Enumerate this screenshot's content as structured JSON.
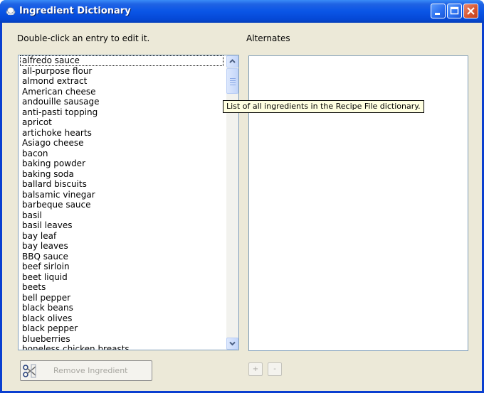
{
  "window": {
    "title": "Ingredient Dictionary",
    "colors": {
      "titlebar": "#0a55e6",
      "frame": "#0a3fd0",
      "body": "#ece9d8",
      "tooltip_bg": "#ffffe1"
    }
  },
  "left_panel": {
    "instruction": "Double-click an entry to edit it.",
    "ingredients": [
      "alfredo sauce",
      "all-purpose flour",
      "almond extract",
      "American cheese",
      "andouille sausage",
      "anti-pasti topping",
      "apricot",
      "artichoke hearts",
      "Asiago cheese",
      "bacon",
      "baking powder",
      "baking soda",
      "ballard biscuits",
      "balsamic vinegar",
      "barbeque sauce",
      "basil",
      "basil leaves",
      "bay leaf",
      "bay leaves",
      "BBQ sauce",
      "beef sirloin",
      "beet liquid",
      "beets",
      "bell pepper",
      "black beans",
      "black olives",
      "black pepper",
      "blueberries",
      "boneless chicken breasts"
    ],
    "selected_index": 0
  },
  "right_panel": {
    "label": "Alternates",
    "items": []
  },
  "tooltip": {
    "text": "List of all ingredients in the Recipe File dictionary."
  },
  "buttons": {
    "remove_label": "Remove Ingredient",
    "add_label": "+",
    "remove_alt_label": "-"
  },
  "icons": {
    "app": "chef-hat-icon",
    "minimize": "minimize-icon",
    "maximize": "maximize-icon",
    "close": "close-icon",
    "remove": "scissors-icon"
  }
}
